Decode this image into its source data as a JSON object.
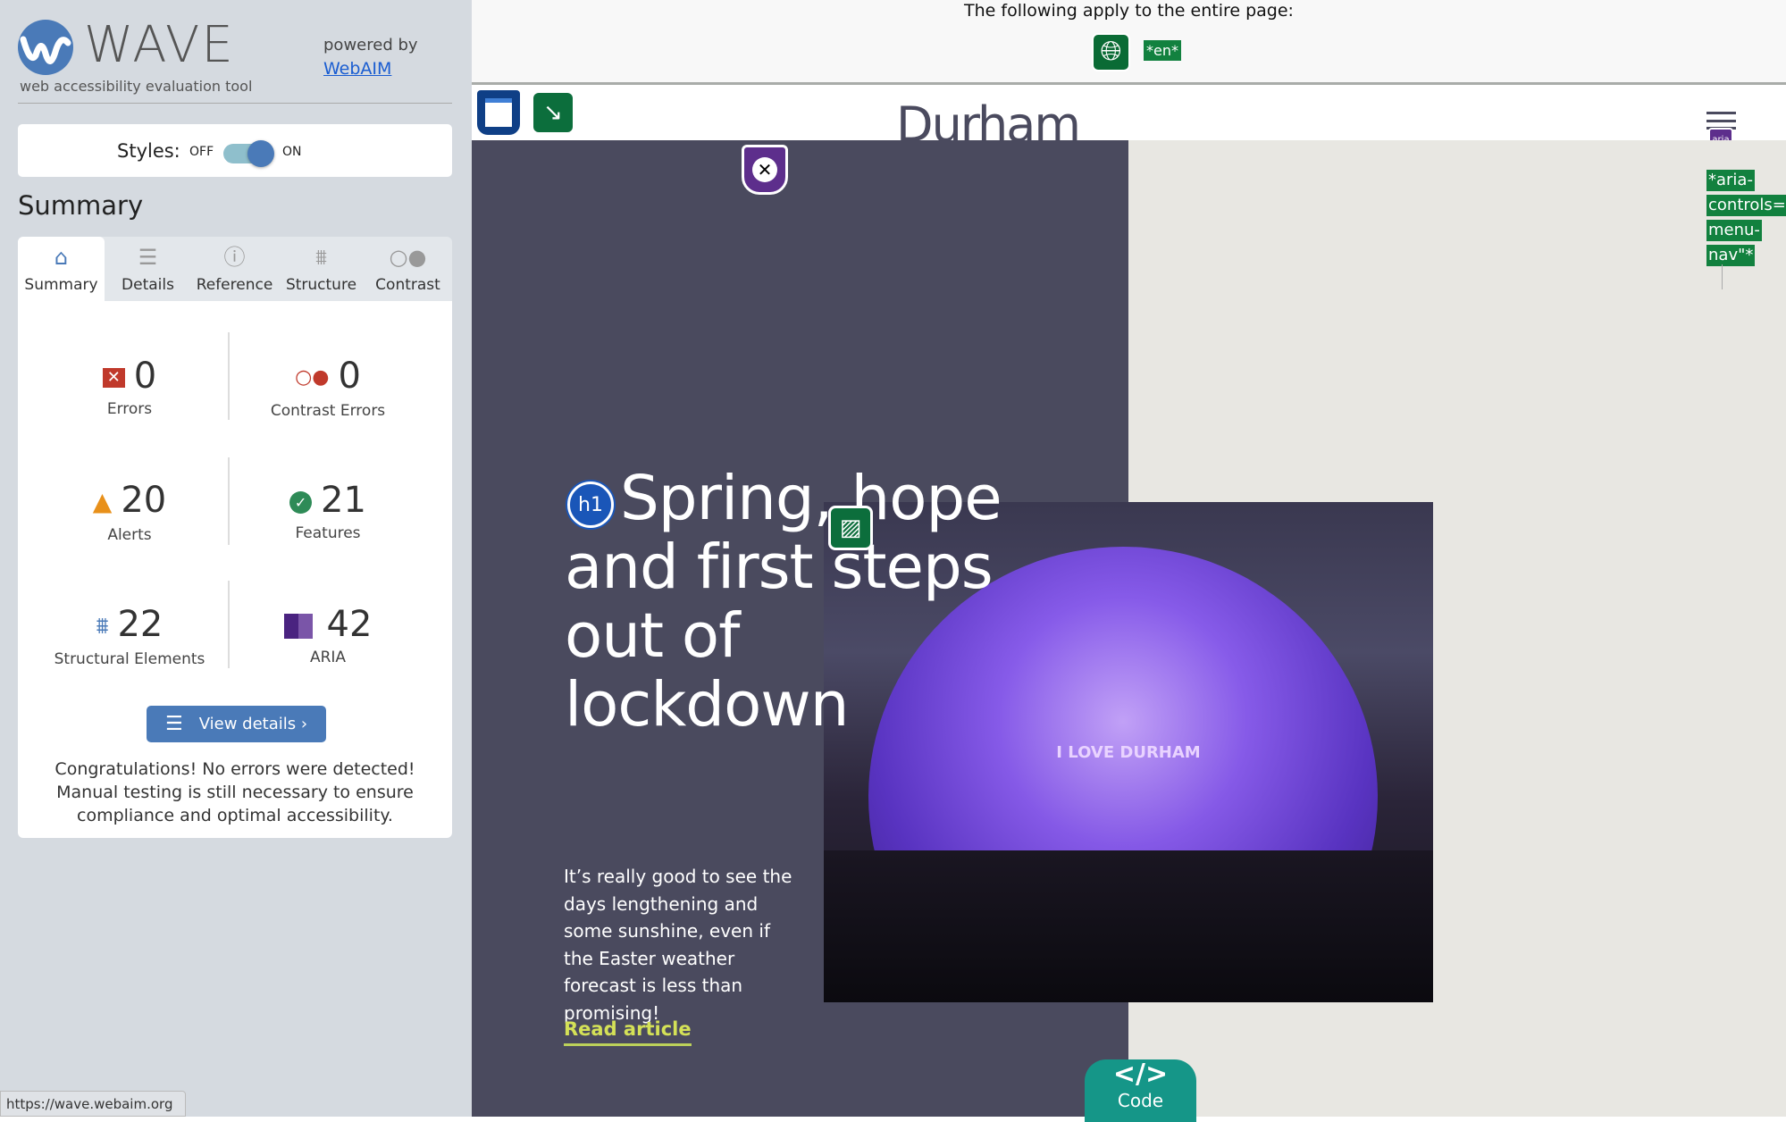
{
  "sidebar": {
    "logo_text": "WAVE",
    "subtitle": "web accessibility evaluation tool",
    "powered_by": "powered by",
    "powered_link": "WebAIM",
    "styles_label": "Styles:",
    "styles_off": "OFF",
    "styles_on": "ON",
    "styles_enabled": true,
    "heading": "Summary",
    "tabs": [
      {
        "label": "Summary",
        "icon": "home-icon",
        "active": true
      },
      {
        "label": "Details",
        "icon": "list-icon"
      },
      {
        "label": "Reference",
        "icon": "info-icon"
      },
      {
        "label": "Structure",
        "icon": "hierarchy-icon"
      },
      {
        "label": "Contrast",
        "icon": "contrast-icon"
      }
    ],
    "stats": [
      {
        "value": "0",
        "label": "Errors",
        "icon": "error-icon",
        "color": "#c0392b"
      },
      {
        "value": "0",
        "label": "Contrast Errors",
        "icon": "contrast-error-icon",
        "color": "#c0392b"
      },
      {
        "value": "20",
        "label": "Alerts",
        "icon": "alert-icon",
        "color": "#e8901a"
      },
      {
        "value": "21",
        "label": "Features",
        "icon": "feature-icon",
        "color": "#2e8b57"
      },
      {
        "value": "22",
        "label": "Structural Elements",
        "icon": "structure-icon",
        "color": "#4a7ab8"
      },
      {
        "value": "42",
        "label": "ARIA",
        "icon": "aria-icon",
        "color": "#5d2e8c"
      }
    ],
    "view_details": "View details ›",
    "congrats": "Congratulations! No errors were detected! Manual testing is still necessary to ensure compliance and optimal accessibility."
  },
  "status_url": "https://wave.webaim.org",
  "page": {
    "banner_text": "The following apply to the entire page:",
    "lang_badge": "*en*",
    "site_name": "Durham",
    "aria_controls": [
      "*aria-",
      "controls=\"",
      "menu-",
      "nav\"*"
    ],
    "aria_icon_text": "aria",
    "h1_badge": "h1",
    "heading": "Spring, hope and first steps out of lockdown",
    "photo_text": "I LOVE DURHAM",
    "paragraph": "It’s really good to see the days lengthening and some sunshine, even if the Easter weather forecast is less than promising!",
    "read_more": "Read article",
    "code_label": "Code",
    "code_glyph": "</>"
  }
}
